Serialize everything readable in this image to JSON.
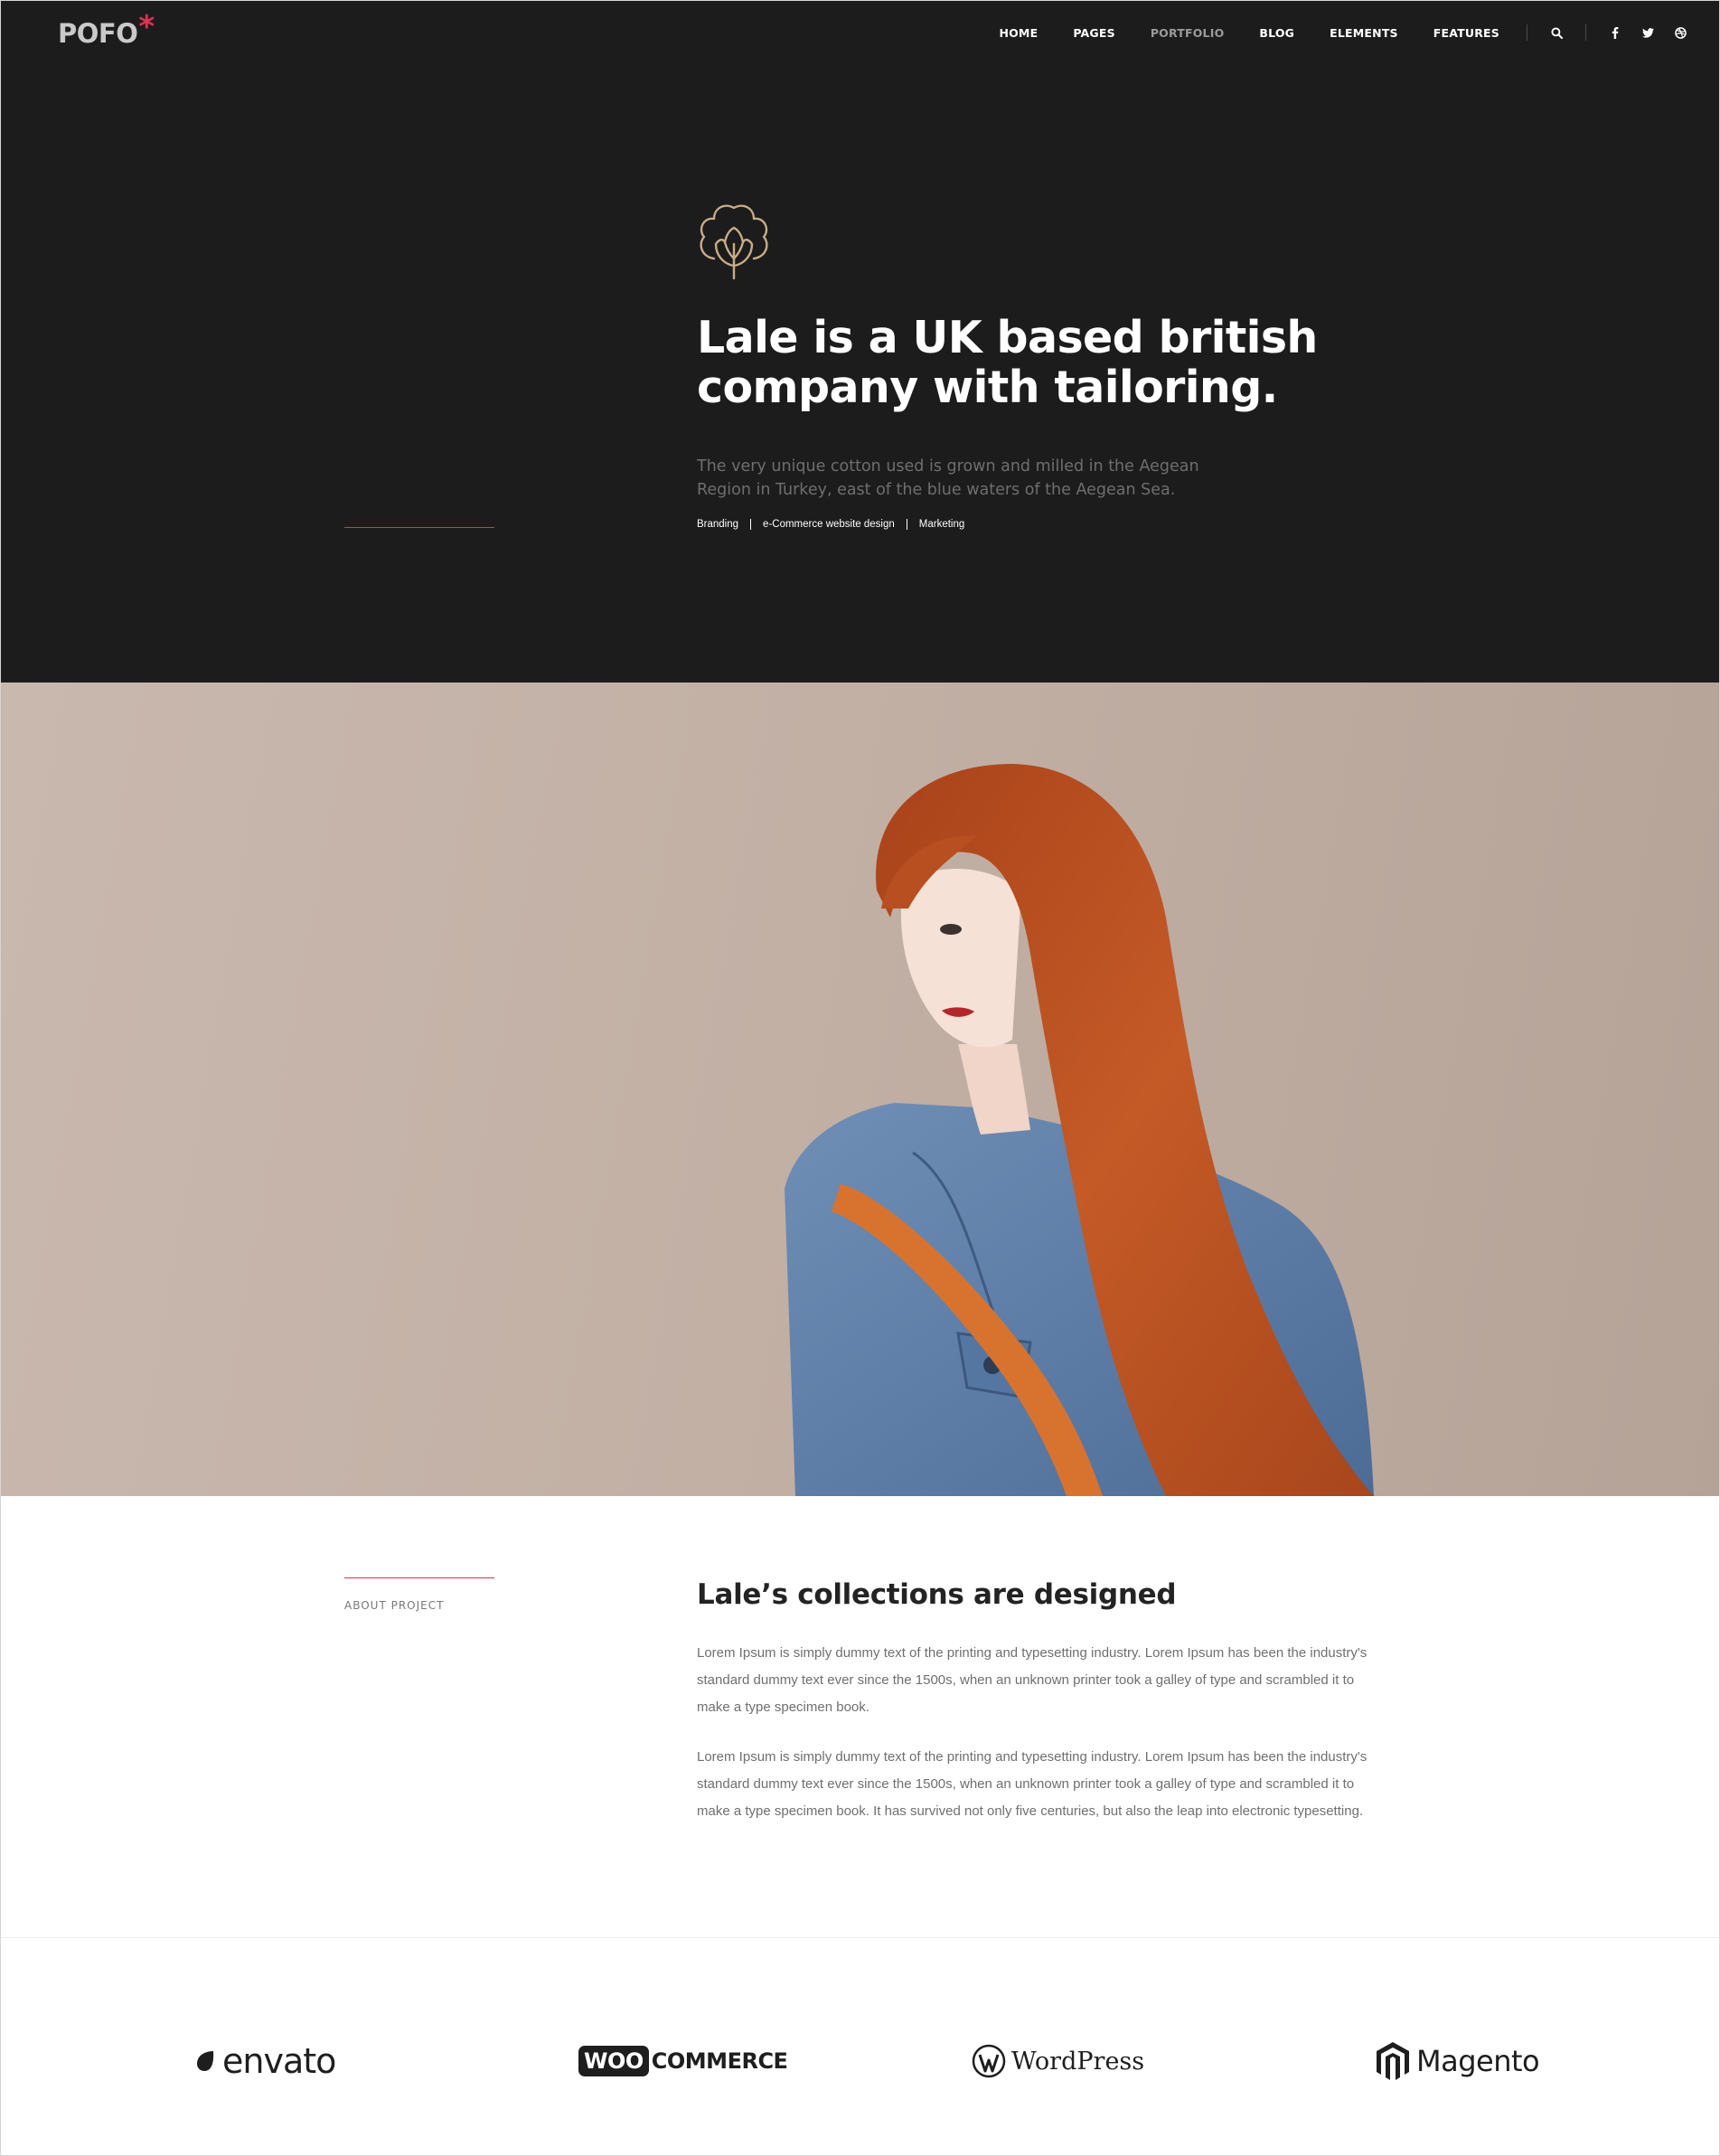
{
  "header": {
    "logo_text": "POFO",
    "logo_mark": "*",
    "nav": [
      {
        "label": "HOME",
        "active": false
      },
      {
        "label": "PAGES",
        "active": false
      },
      {
        "label": "PORTFOLIO",
        "active": true
      },
      {
        "label": "BLOG",
        "active": false
      },
      {
        "label": "ELEMENTS",
        "active": false
      },
      {
        "label": "FEATURES",
        "active": false
      }
    ],
    "icons": [
      "search-icon",
      "facebook-icon",
      "twitter-icon",
      "dribbble-icon"
    ]
  },
  "hero": {
    "icon": "cotton-flower-icon",
    "title_line1": "Lale is a UK based british",
    "title_line2": "company with tailoring.",
    "description": "The very unique cotton used is grown and milled in the Aegean Region in Turkey, east of the blue waters of the Aegean Sea.",
    "tags": [
      "Branding",
      "e-Commerce website design",
      "Marketing"
    ]
  },
  "about": {
    "label": "ABOUT PROJECT",
    "title": "Lale’s collections are designed",
    "paragraph1": "Lorem Ipsum is simply dummy text of the printing and typesetting industry. Lorem Ipsum has been the industry's standard dummy text ever since the 1500s, when an unknown printer took a galley of type and scrambled it to make a type specimen book.",
    "paragraph2": "Lorem Ipsum is simply dummy text of the printing and typesetting industry. Lorem Ipsum has been the industry's standard dummy text ever since the 1500s, when an unknown printer took a galley of type and scrambled it to make a type specimen book. It has survived not only five centuries, but also the leap into electronic typesetting."
  },
  "clients": {
    "envato": "envato",
    "woo_box": "WOO",
    "woo_text": "COMMERCE",
    "wordpress": "WordPress",
    "magento": "Magento"
  },
  "colors": {
    "hero_bg": "#1c1c1d",
    "accent": "#e2314e",
    "icon_gold": "#c9ac86",
    "photo_bg": "#c2b0a5"
  }
}
